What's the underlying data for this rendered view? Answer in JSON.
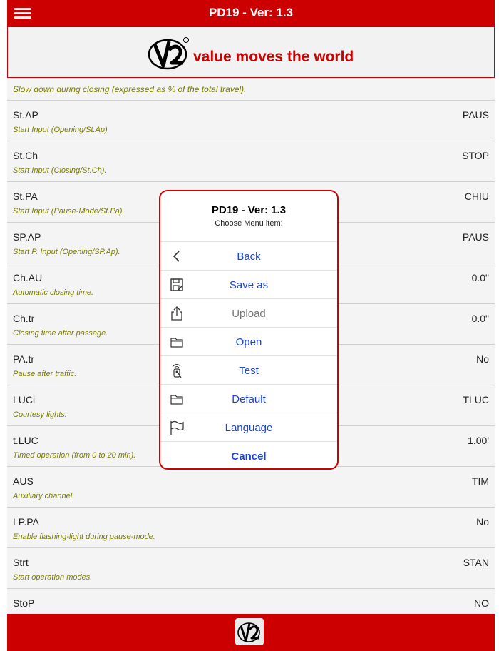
{
  "header": {
    "title": "PD19 - Ver: 1.3"
  },
  "banner": {
    "tagline": "value moves the world"
  },
  "list": {
    "top_desc": "Slow down during closing (expressed as % of the total travel).",
    "rows": [
      {
        "code": "St.AP",
        "desc": "Start Input (Opening/St.Ap)",
        "value": "PAUS"
      },
      {
        "code": "St.Ch",
        "desc": "Start Input (Closing/St.Ch).",
        "value": "STOP"
      },
      {
        "code": "St.PA",
        "desc": "Start Input (Pause-Mode/St.Pa).",
        "value": "CHIU"
      },
      {
        "code": "SP.AP",
        "desc": "Start P. Input (Opening/SP.Ap).",
        "value": "PAUS"
      },
      {
        "code": "Ch.AU",
        "desc": "Automatic closing time.",
        "value": "0.0\""
      },
      {
        "code": "Ch.tr",
        "desc": "Closing time after passage.",
        "value": "0.0\""
      },
      {
        "code": "PA.tr",
        "desc": "Pause after traffic.",
        "value": "No"
      },
      {
        "code": "LUCi",
        "desc": "Courtesy lights.",
        "value": "TLUC"
      },
      {
        "code": "t.LUC",
        "desc": "Timed operation (from 0 to 20 min).",
        "value": "1.00'"
      },
      {
        "code": "AUS",
        "desc": "Auxiliary channel.",
        "value": "TIM"
      },
      {
        "code": "LP.PA",
        "desc": "Enable flashing-light during pause-mode.",
        "value": "No"
      },
      {
        "code": "Strt",
        "desc": "Start operation modes.",
        "value": "STAN"
      },
      {
        "code": "StoP",
        "desc": "",
        "value": "NO"
      }
    ]
  },
  "dialog": {
    "title": "PD19 - Ver: 1.3",
    "subtitle": "Choose Menu item:",
    "items": [
      {
        "label": "Back",
        "icon": "chevron-left-icon"
      },
      {
        "label": "Save as",
        "icon": "save-icon"
      },
      {
        "label": "Upload",
        "icon": "upload-icon"
      },
      {
        "label": "Open",
        "icon": "folder-icon"
      },
      {
        "label": "Test",
        "icon": "remote-icon"
      },
      {
        "label": "Default",
        "icon": "folder-icon"
      },
      {
        "label": "Language",
        "icon": "flag-icon"
      },
      {
        "label": "Cancel",
        "icon": ""
      }
    ]
  },
  "colors": {
    "brand_red": "#cc0000",
    "link_blue": "#1a44d6",
    "desc_olive": "#7a7a00"
  }
}
